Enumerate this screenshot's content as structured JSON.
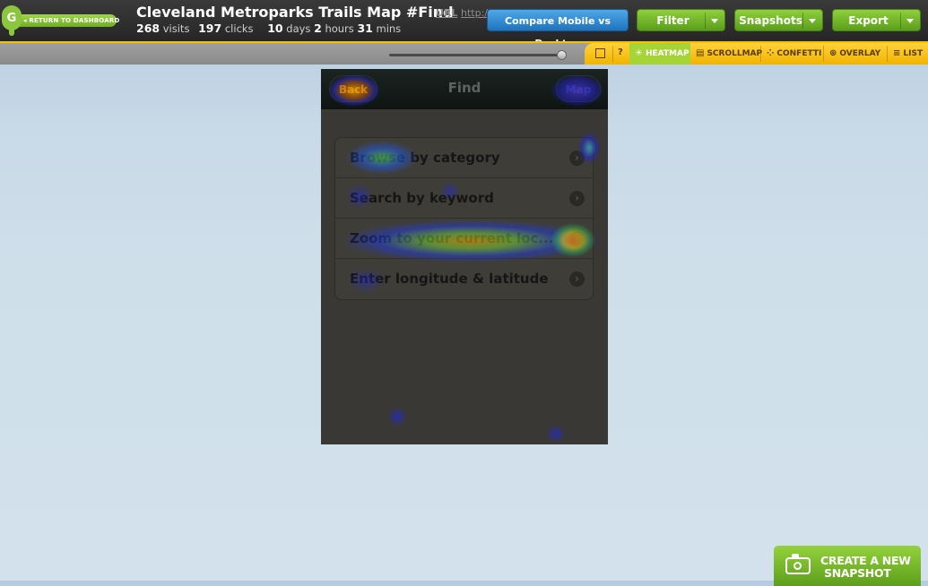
{
  "header": {
    "logo_letter": "G",
    "return_label": "◂ RETURN TO DASHBOARD",
    "title": "Cleveland Metroparks Trails Map #Find",
    "url_label": "URL",
    "url_value": "http://",
    "stats": {
      "visits_value": "268",
      "visits_label": "visits",
      "clicks_value": "197",
      "clicks_label": "clicks",
      "days_value": "10",
      "days_label": "days",
      "hours_value": "2",
      "hours_label": "hours",
      "mins_value": "31",
      "mins_label": "mins"
    },
    "buttons": {
      "compare": "Compare Mobile vs Desktop",
      "filter": "Filter",
      "snapshots": "Snapshots",
      "export": "Export"
    }
  },
  "toolbar": {
    "zoom_slider_value": 0.97,
    "help": "?",
    "tools": {
      "heatmap": "HEATMAP",
      "scrollmap": "SCROLLMAP",
      "confetti": "CONFETTI",
      "overlay": "OVERLAY",
      "list": "LIST"
    },
    "active_tool": "heatmap",
    "accent_color": "#f0b400",
    "active_color": "#a6d336"
  },
  "phone": {
    "nav_title": "Find",
    "back_label": "Back",
    "map_label": "Map",
    "menu_items": [
      {
        "label": "Browse by category"
      },
      {
        "label": "Search by keyword"
      },
      {
        "label": "Zoom to your current loc..."
      },
      {
        "label": "Enter longitude & latitude"
      }
    ]
  },
  "snapshot_button": {
    "line1": "CREATE A NEW",
    "line2": "SNAPSHOT"
  },
  "icons": {
    "camera": "camera-icon",
    "expand": "expand-icon",
    "chevron": "chevron-right-icon"
  }
}
